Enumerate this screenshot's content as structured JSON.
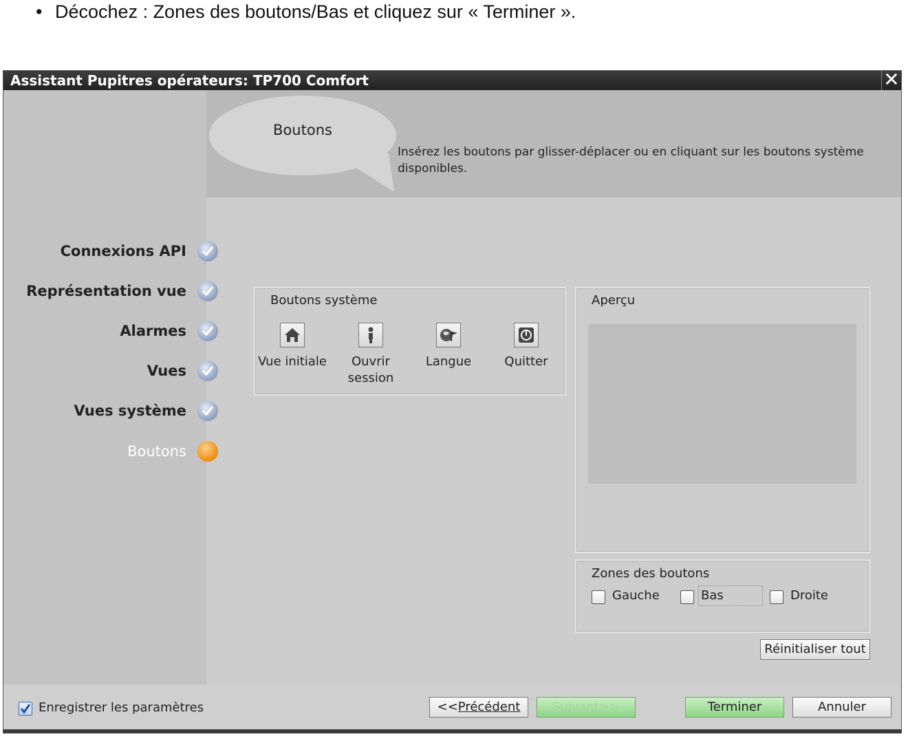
{
  "instruction": {
    "bullet": "•",
    "text": "Décochez : Zones des boutons/Bas et cliquez sur « Terminer »."
  },
  "dialog": {
    "title": "Assistant Pupitres opérateurs: TP700 Comfort",
    "close_symbol": "✕",
    "header": {
      "bubble_title": "Boutons",
      "description": "Insérez les boutons par glisser-déplacer ou en cliquant sur les boutons système disponibles."
    },
    "nav": {
      "items": [
        {
          "label": "Connexions API",
          "state": "done"
        },
        {
          "label": "Représentation vue",
          "state": "done"
        },
        {
          "label": "Alarmes",
          "state": "done"
        },
        {
          "label": "Vues",
          "state": "done"
        },
        {
          "label": "Vues système",
          "state": "done"
        },
        {
          "label": "Boutons",
          "state": "current"
        }
      ]
    },
    "system_buttons": {
      "title": "Boutons système",
      "items": [
        {
          "label": "Vue initiale",
          "icon": "home-icon"
        },
        {
          "label": "Ouvrir session",
          "icon": "user-icon"
        },
        {
          "label": "Langue",
          "icon": "globe-flag-icon"
        },
        {
          "label": "Quitter",
          "icon": "power-icon"
        }
      ]
    },
    "preview": {
      "title": "Aperçu"
    },
    "zones": {
      "title": "Zones des boutons",
      "options": [
        {
          "label": "Gauche",
          "checked": false
        },
        {
          "label": "Bas",
          "checked": false
        },
        {
          "label": "Droite",
          "checked": false
        }
      ]
    },
    "reset_label": "Réinitialiser tout",
    "save_settings": {
      "label": "Enregistrer les paramètres",
      "checked": true
    },
    "footer": {
      "prev_prefix": "<<",
      "prev_label": "Précédent",
      "next_label": "Suivant>>",
      "finish_label": "Terminer",
      "cancel_label": "Annuler"
    },
    "colors": {
      "titlebar": "#2b2b2b",
      "current_step": "#f28a0c",
      "done_step": "#8e9ebd",
      "finish_button": "#8fd488"
    }
  }
}
